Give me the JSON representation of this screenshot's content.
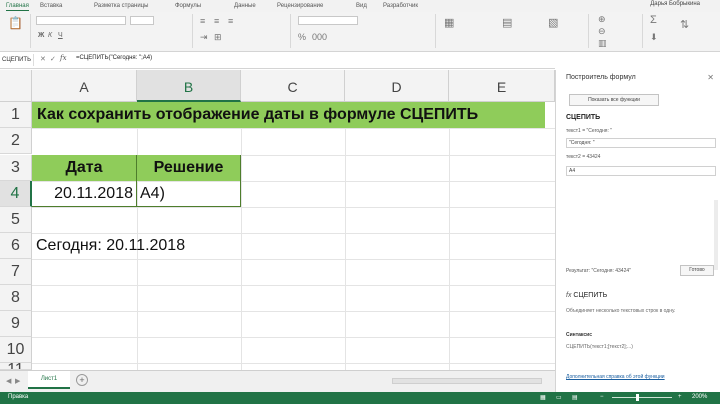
{
  "ribbon_tabs": [
    "Главная",
    "Вставка",
    "Разметка страницы",
    "Формулы",
    "Данные",
    "Рецензирование",
    "Вид",
    "Разработчик"
  ],
  "active_tab": "Главная",
  "user": "Дарья Бобрыкина",
  "formula_bar": {
    "name_box": "СЦЕПИТЬ",
    "cancel": "✕",
    "enter": "✓",
    "fx": "fx",
    "formula": "=СЦЕПИТЬ(\"Сегодня: \";A4)"
  },
  "columns": [
    "A",
    "B",
    "C",
    "D",
    "E"
  ],
  "selected_column": "B",
  "rows": [
    "1",
    "2",
    "3",
    "4",
    "5",
    "6",
    "7",
    "8",
    "9",
    "10",
    "11"
  ],
  "selected_row": "4",
  "sheet": {
    "title": "Как сохранить отображение даты в формуле СЦЕПИТЬ",
    "header_date": "Дата",
    "header_solution": "Решение",
    "date_value": "20.11.2018",
    "solution_value": "A4)",
    "today_text": "Сегодня: 20.11.2018"
  },
  "sheet_tabs": [
    "Лист1"
  ],
  "status": {
    "mode": "Правка",
    "zoom": "200%"
  },
  "formula_builder": {
    "title": "Построитель формул",
    "close": "✕",
    "insert_button": "Показать все функции",
    "function_name": "СЦЕПИТЬ",
    "arg1_label": "текст1 = \"Сегодня: \"",
    "arg1_value": "\"Сегодня: \"",
    "arg2_label": "текст2 = 43424",
    "arg2_value": "A4",
    "result_label": "Результат: \"Сегодня: 43424\"",
    "done": "Готово",
    "fx_title": "СЦЕПИТЬ",
    "description": "Объединяет несколько текстовых строк в одну.",
    "syntax_title": "Синтаксис",
    "syntax": "СЦЕПИТЬ(текст1;[текст2];...)",
    "more_help": "Дополнительная справка об этой функции"
  },
  "accent_color": "#217346",
  "highlight_color": "#8fcc5a"
}
